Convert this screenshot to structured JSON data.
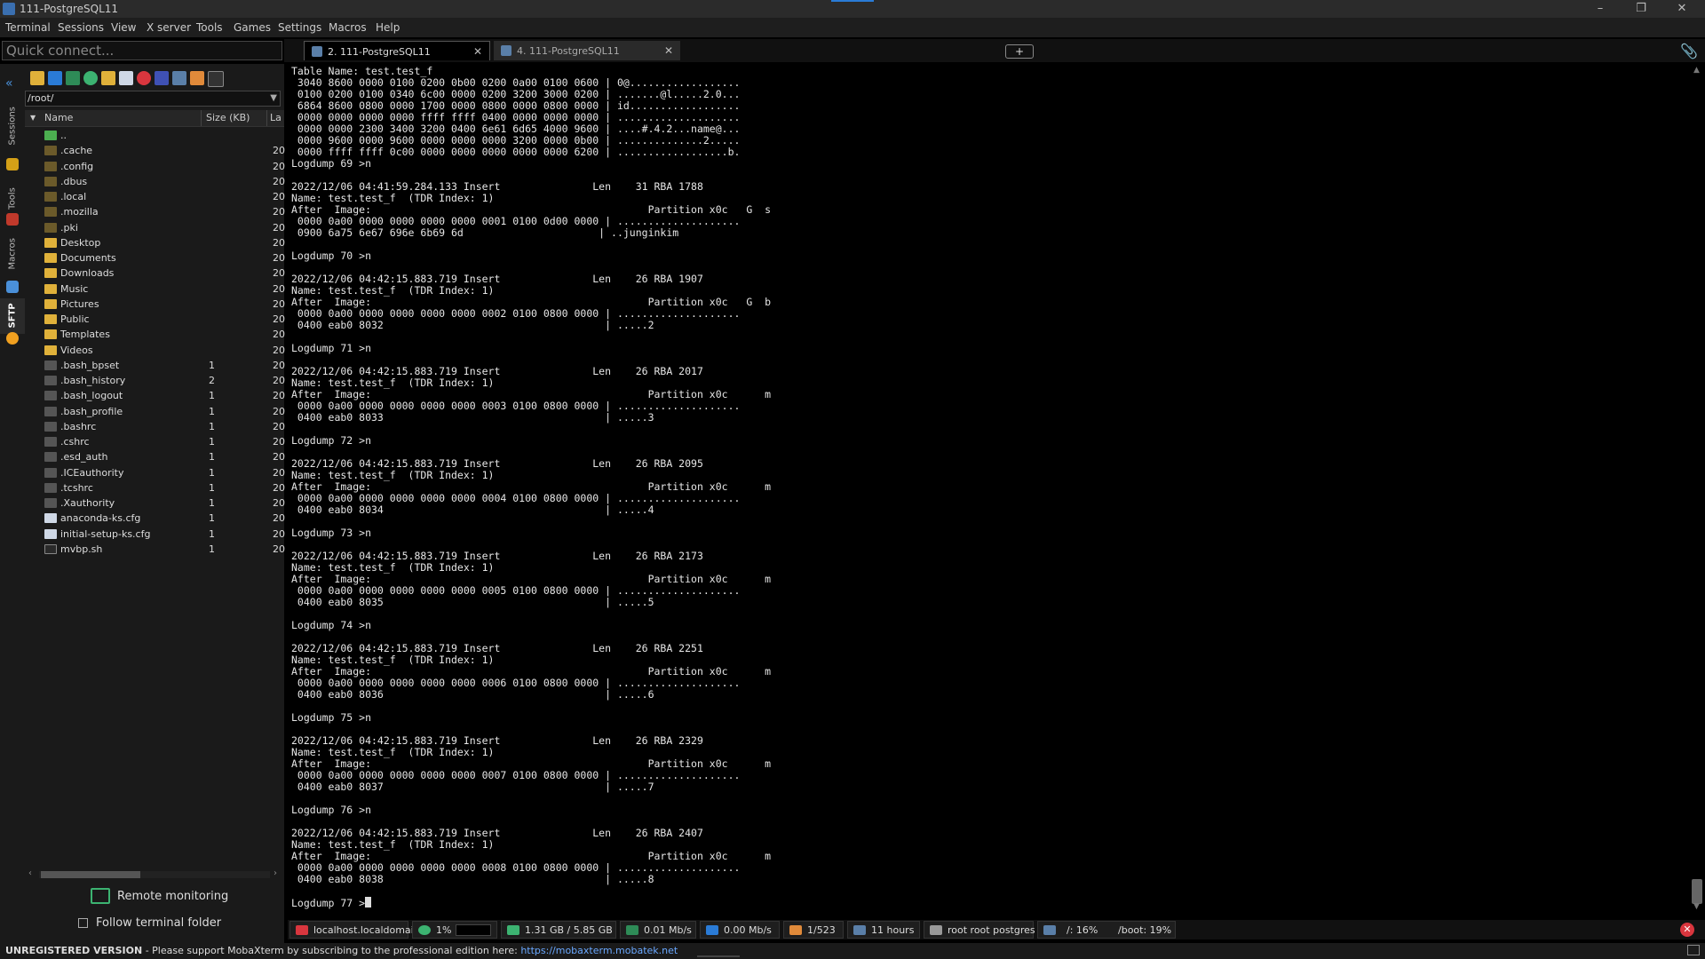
{
  "window": {
    "title": "111-PostgreSQL11"
  },
  "menu": [
    "Terminal",
    "Sessions",
    "View",
    "X server",
    "Tools",
    "Games",
    "Settings",
    "Macros",
    "Help"
  ],
  "quick_connect": {
    "placeholder": "Quick connect..."
  },
  "side_tabs": [
    "Sessions",
    "Tools",
    "Macros",
    "SFTP"
  ],
  "sftp": {
    "path": "/root/",
    "columns": [
      "Name",
      "Size (KB)",
      "La"
    ],
    "files": [
      {
        "name": "..",
        "size": "",
        "date": "",
        "type": "up"
      },
      {
        "name": ".cache",
        "size": "",
        "date": "20",
        "type": "hidden"
      },
      {
        "name": ".config",
        "size": "",
        "date": "20",
        "type": "hidden"
      },
      {
        "name": ".dbus",
        "size": "",
        "date": "20",
        "type": "hidden"
      },
      {
        "name": ".local",
        "size": "",
        "date": "20",
        "type": "hidden"
      },
      {
        "name": ".mozilla",
        "size": "",
        "date": "20",
        "type": "hidden"
      },
      {
        "name": ".pki",
        "size": "",
        "date": "20",
        "type": "hidden"
      },
      {
        "name": "Desktop",
        "size": "",
        "date": "20",
        "type": "folder"
      },
      {
        "name": "Documents",
        "size": "",
        "date": "20",
        "type": "folder"
      },
      {
        "name": "Downloads",
        "size": "",
        "date": "20",
        "type": "folder"
      },
      {
        "name": "Music",
        "size": "",
        "date": "20",
        "type": "folder"
      },
      {
        "name": "Pictures",
        "size": "",
        "date": "20",
        "type": "folder"
      },
      {
        "name": "Public",
        "size": "",
        "date": "20",
        "type": "folder"
      },
      {
        "name": "Templates",
        "size": "",
        "date": "20",
        "type": "folder"
      },
      {
        "name": "Videos",
        "size": "",
        "date": "20",
        "type": "folder"
      },
      {
        "name": ".bash_bpset",
        "size": "1",
        "date": "20",
        "type": "file"
      },
      {
        "name": ".bash_history",
        "size": "2",
        "date": "20",
        "type": "file"
      },
      {
        "name": ".bash_logout",
        "size": "1",
        "date": "20",
        "type": "file"
      },
      {
        "name": ".bash_profile",
        "size": "1",
        "date": "20",
        "type": "file"
      },
      {
        "name": ".bashrc",
        "size": "1",
        "date": "20",
        "type": "file"
      },
      {
        "name": ".cshrc",
        "size": "1",
        "date": "20",
        "type": "file"
      },
      {
        "name": ".esd_auth",
        "size": "1",
        "date": "20",
        "type": "file"
      },
      {
        "name": ".ICEauthority",
        "size": "1",
        "date": "20",
        "type": "file"
      },
      {
        "name": ".tcshrc",
        "size": "1",
        "date": "20",
        "type": "file"
      },
      {
        "name": ".Xauthority",
        "size": "1",
        "date": "20",
        "type": "file"
      },
      {
        "name": "anaconda-ks.cfg",
        "size": "1",
        "date": "20",
        "type": "cfg"
      },
      {
        "name": "initial-setup-ks.cfg",
        "size": "1",
        "date": "20",
        "type": "cfg"
      },
      {
        "name": "mvbp.sh",
        "size": "1",
        "date": "20",
        "type": "script"
      }
    ],
    "remote_monitoring": "Remote monitoring",
    "follow_terminal": "Follow terminal folder"
  },
  "tabs": [
    {
      "label": "2. 111-PostgreSQL11",
      "active": true
    },
    {
      "label": "4. 111-PostgreSQL11",
      "active": false
    }
  ],
  "new_tab": "+",
  "terminal": {
    "lines": [
      "Table Name: test.test_f",
      " 3040 8600 0000 0100 0200 0b00 0200 0a00 0100 0600 | 0@..................",
      " 0100 0200 0100 0340 6c00 0000 0200 3200 3000 0200 | .......@l.....2.0...",
      " 6864 8600 0800 0000 1700 0000 0800 0000 0800 0000 | id..................",
      " 0000 0000 0000 0000 ffff ffff 0400 0000 0000 0000 | ....................",
      " 0000 0000 2300 3400 3200 0400 6e61 6d65 4000 9600 | ....#.4.2...name@...",
      " 0000 9600 0000 9600 0000 0000 0000 3200 0000 0b00 | ..............2.....",
      " 0000 ffff ffff 0c00 0000 0000 0000 0000 0000 6200 | ..................b.",
      "Logdump 69 >n",
      "",
      "2022/12/06 04:41:59.284.133 Insert               Len    31 RBA 1788",
      "Name: test.test_f  (TDR Index: 1)",
      "After  Image:                                             Partition x0c   G  s",
      " 0000 0a00 0000 0000 0000 0000 0001 0100 0d00 0000 | ....................",
      " 0900 6a75 6e67 696e 6b69 6d                      | ..junginkim",
      "",
      "Logdump 70 >n",
      "",
      "2022/12/06 04:42:15.883.719 Insert               Len    26 RBA 1907",
      "Name: test.test_f  (TDR Index: 1)",
      "After  Image:                                             Partition x0c   G  b",
      " 0000 0a00 0000 0000 0000 0000 0002 0100 0800 0000 | ....................",
      " 0400 eab0 8032                                    | .....2",
      "",
      "Logdump 71 >n",
      "",
      "2022/12/06 04:42:15.883.719 Insert               Len    26 RBA 2017",
      "Name: test.test_f  (TDR Index: 1)",
      "After  Image:                                             Partition x0c      m",
      " 0000 0a00 0000 0000 0000 0000 0003 0100 0800 0000 | ....................",
      " 0400 eab0 8033                                    | .....3",
      "",
      "Logdump 72 >n",
      "",
      "2022/12/06 04:42:15.883.719 Insert               Len    26 RBA 2095",
      "Name: test.test_f  (TDR Index: 1)",
      "After  Image:                                             Partition x0c      m",
      " 0000 0a00 0000 0000 0000 0000 0004 0100 0800 0000 | ....................",
      " 0400 eab0 8034                                    | .....4",
      "",
      "Logdump 73 >n",
      "",
      "2022/12/06 04:42:15.883.719 Insert               Len    26 RBA 2173",
      "Name: test.test_f  (TDR Index: 1)",
      "After  Image:                                             Partition x0c      m",
      " 0000 0a00 0000 0000 0000 0000 0005 0100 0800 0000 | ....................",
      " 0400 eab0 8035                                    | .....5",
      "",
      "Logdump 74 >n",
      "",
      "2022/12/06 04:42:15.883.719 Insert               Len    26 RBA 2251",
      "Name: test.test_f  (TDR Index: 1)",
      "After  Image:                                             Partition x0c      m",
      " 0000 0a00 0000 0000 0000 0000 0006 0100 0800 0000 | ....................",
      " 0400 eab0 8036                                    | .....6",
      "",
      "Logdump 75 >n",
      "",
      "2022/12/06 04:42:15.883.719 Insert               Len    26 RBA 2329",
      "Name: test.test_f  (TDR Index: 1)",
      "After  Image:                                             Partition x0c      m",
      " 0000 0a00 0000 0000 0000 0000 0007 0100 0800 0000 | ....................",
      " 0400 eab0 8037                                    | .....7",
      "",
      "Logdump 76 >n",
      "",
      "2022/12/06 04:42:15.883.719 Insert               Len    26 RBA 2407",
      "Name: test.test_f  (TDR Index: 1)",
      "After  Image:                                             Partition x0c      m",
      " 0000 0a00 0000 0000 0000 0000 0008 0100 0800 0000 | ....................",
      " 0400 eab0 8038                                    | .....8",
      "",
      "Logdump 77 >"
    ]
  },
  "status": {
    "host": "localhost.localdomain",
    "cpu": "1%",
    "memory": "1.31 GB / 5.85 GB",
    "upload": "0.01 Mb/s",
    "download": "0.00 Mb/s",
    "processes": "1/523",
    "uptime": "11 hours",
    "users": "root  root  postgres",
    "disk": "/: 16%",
    "boot": "/boot: 19%"
  },
  "footer": {
    "unregistered": "UNREGISTERED VERSION",
    "message": "  -  Please support MobaXterm by subscribing to the professional edition here:  ",
    "link": "https://mobaxterm.mobatek.net"
  },
  "colors": {
    "folder": "#e0b13a",
    "accent": "#2a7bd6",
    "link": "#6aa8ff",
    "error": "#d9363e"
  }
}
